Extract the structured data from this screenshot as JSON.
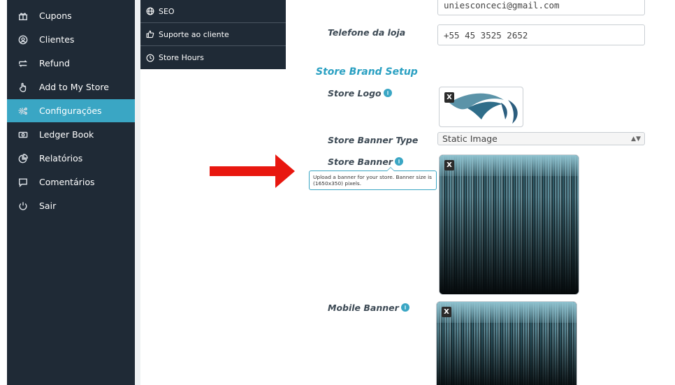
{
  "sidebar": {
    "items": [
      {
        "label": "Cupons",
        "icon": "gift-icon"
      },
      {
        "label": "Clientes",
        "icon": "user-circle-icon"
      },
      {
        "label": "Refund",
        "icon": "refund-icon"
      },
      {
        "label": "Add to My Store",
        "icon": "hand-pointer-icon"
      },
      {
        "label": "Configurações",
        "icon": "settings-icon",
        "active": true
      },
      {
        "label": "Ledger Book",
        "icon": "money-icon"
      },
      {
        "label": "Relatórios",
        "icon": "pie-chart-icon"
      },
      {
        "label": "Comentários",
        "icon": "comment-icon"
      },
      {
        "label": "Sair",
        "icon": "power-icon"
      }
    ]
  },
  "submenu": {
    "items": [
      {
        "label": "SEO",
        "icon": "globe-icon"
      },
      {
        "label": "Suporte ao cliente",
        "icon": "thumbs-up-icon"
      },
      {
        "label": "Store Hours",
        "icon": "clock-icon"
      }
    ]
  },
  "form": {
    "email_value": "uniesconceci@gmail.com",
    "phone_label": "Telefone da loja",
    "phone_value": "+55 45 3525 2652",
    "brand_section_title": "Store Brand Setup",
    "logo_label": "Store Logo",
    "banner_type_label": "Store Banner Type",
    "banner_type_value": "Static Image",
    "banner_label": "Store Banner",
    "banner_tooltip": "Upload a banner for your store. Banner size is (1650x350) pixels.",
    "mobile_banner_label": "Mobile Banner",
    "remove_label": "X"
  },
  "colors": {
    "sidebar_bg": "#1f2a36",
    "active_item": "#3aa6c4",
    "section_title": "#2aa0c2",
    "annotation_arrow": "#e8170f"
  }
}
